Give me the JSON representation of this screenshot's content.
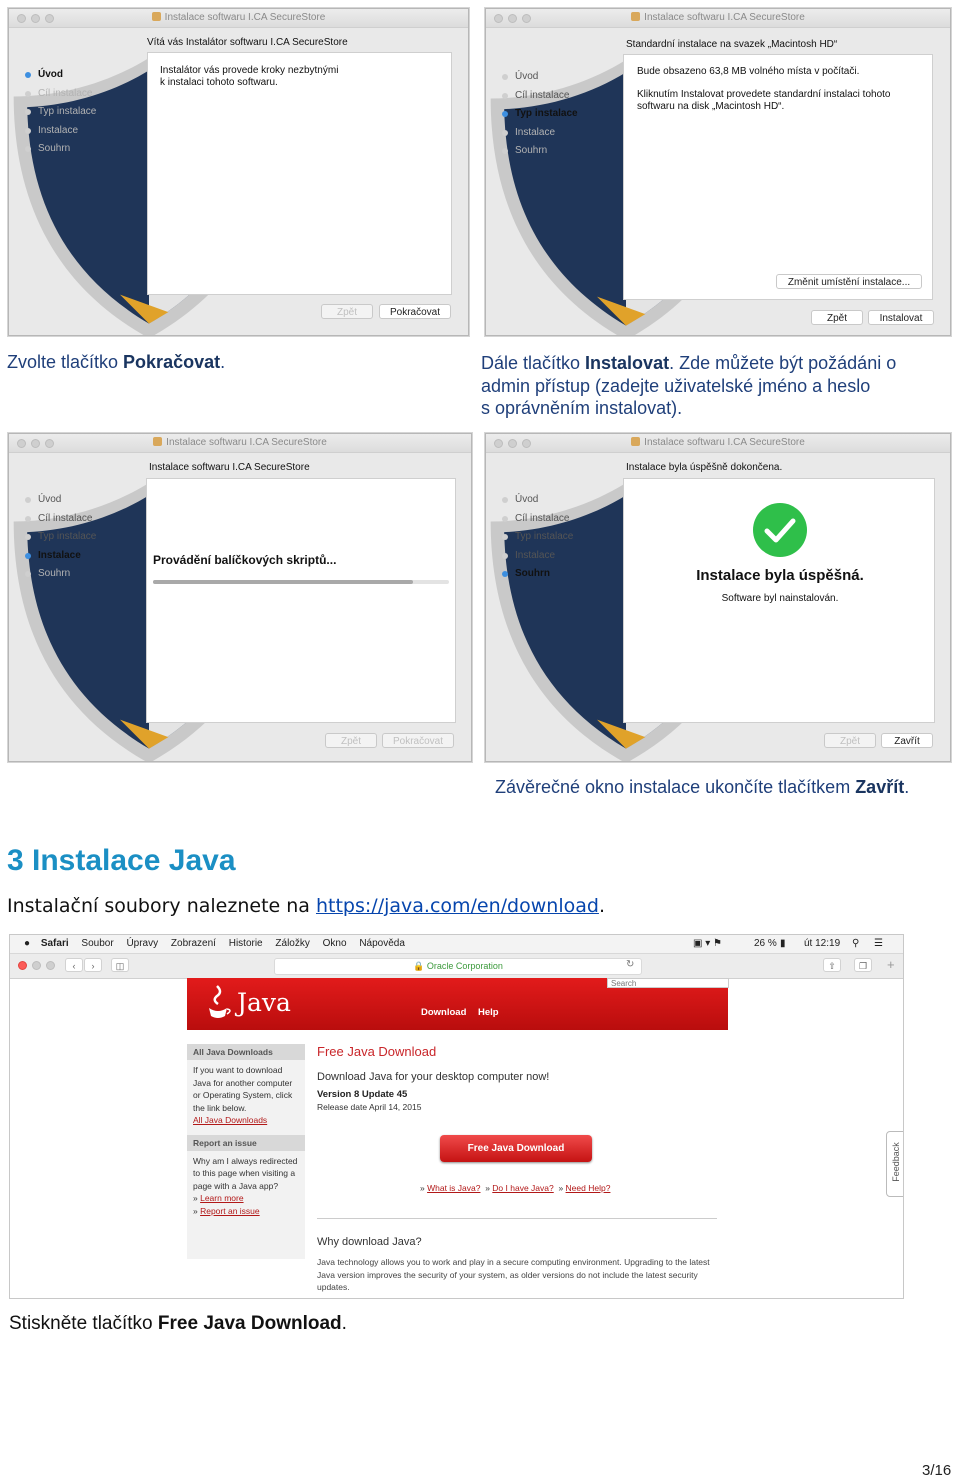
{
  "installer": {
    "window_title": "Instalace softwaru I.CA SecureStore",
    "steps": [
      "Úvod",
      "Cíl instalace",
      "Typ instalace",
      "Instalace",
      "Souhrn"
    ],
    "win1": {
      "subtitle": "Vítá vás Instalátor softwaru I.CA SecureStore",
      "body_line1": "Instalátor vás provede kroky nezbytnými",
      "body_line2": "k instalaci tohoto softwaru.",
      "back": "Zpět",
      "next": "Pokračovat"
    },
    "win2": {
      "subtitle": "Standardní instalace na svazek „Macintosh HD“",
      "space": "Bude obsazeno 63,8 MB volného místa v počítači.",
      "body_line1": "Kliknutím Instalovat provedete standardní instalaci tohoto",
      "body_line2": "softwaru na disk „Macintosh HD“.",
      "change_location": "Změnit umístění instalace...",
      "back": "Zpět",
      "install": "Instalovat"
    },
    "win3": {
      "subtitle": "Instalace softwaru I.CA SecureStore",
      "status": "Provádění balíčkových skriptů...",
      "progress": 0.88,
      "back": "Zpět",
      "next": "Pokračovat"
    },
    "win4": {
      "subtitle": "Instalace byla úspěšně dokončena.",
      "success_title": "Instalace byla úspěšná.",
      "success_text": "Software byl nainstalován.",
      "back": "Zpět",
      "close": "Zavřít"
    }
  },
  "captions": {
    "c1_pre": "Zvolte tlačítko ",
    "c1_bold": "Pokračovat",
    "c1_post": ".",
    "c2_pre": "Dále tlačítko ",
    "c2_bold": "Instalovat",
    "c2_line1_rest": ". Zde můžete být požádáni o",
    "c2_line2": "admin přístup (zadejte uživatelské jméno a heslo",
    "c2_line3": "s oprávněním instalovat).",
    "c3_pre": "Závěrečné okno instalace ukončíte tlačítkem ",
    "c3_bold": "Zavřít",
    "c3_post": "."
  },
  "section": {
    "heading": "3 Instalace Java",
    "intro_pre": "Instalační soubory naleznete na ",
    "intro_link": "https://java.com/en/download",
    "intro_post": "."
  },
  "safari": {
    "menu": [
      "Safari",
      "Soubor",
      "Úpravy",
      "Zobrazení",
      "Historie",
      "Záložky",
      "Okno",
      "Nápověda"
    ],
    "status_battery": "26 %",
    "status_time": "út 12:19",
    "url_text": "🔒 Oracle Corporation",
    "search_placeholder": "Search",
    "java_logo": "Java",
    "nav_download": "Download",
    "nav_help": "Help",
    "sidebar": {
      "h1": "All Java Downloads",
      "t1": "If you want to download Java for another computer or Operating System, click the link below.",
      "l1": "All Java Downloads",
      "h2": "Report an issue",
      "t2": "Why am I always redirected to this page when visiting a page with a Java app?",
      "l2": "Learn more",
      "l3": "Report an issue"
    },
    "main": {
      "title": "Free Java Download",
      "lead": "Download Java for your desktop computer now!",
      "version": "Version 8 Update 45",
      "release": "Release date April 14, 2015",
      "button": "Free Java Download",
      "link1": "What is Java?",
      "link2": "Do I have Java?",
      "link3": "Need Help?",
      "why_title": "Why download Java?",
      "why_text": "Java technology allows you to work and play in a secure computing environment. Upgrading to the latest Java version improves the security of your system, as older versions do not include the latest security updates."
    },
    "feedback": "Feedback"
  },
  "bottom_caption": {
    "pre": "Stiskněte tlačítko ",
    "bold": "Free Java Download",
    "post": "."
  },
  "page_number": "3/16"
}
